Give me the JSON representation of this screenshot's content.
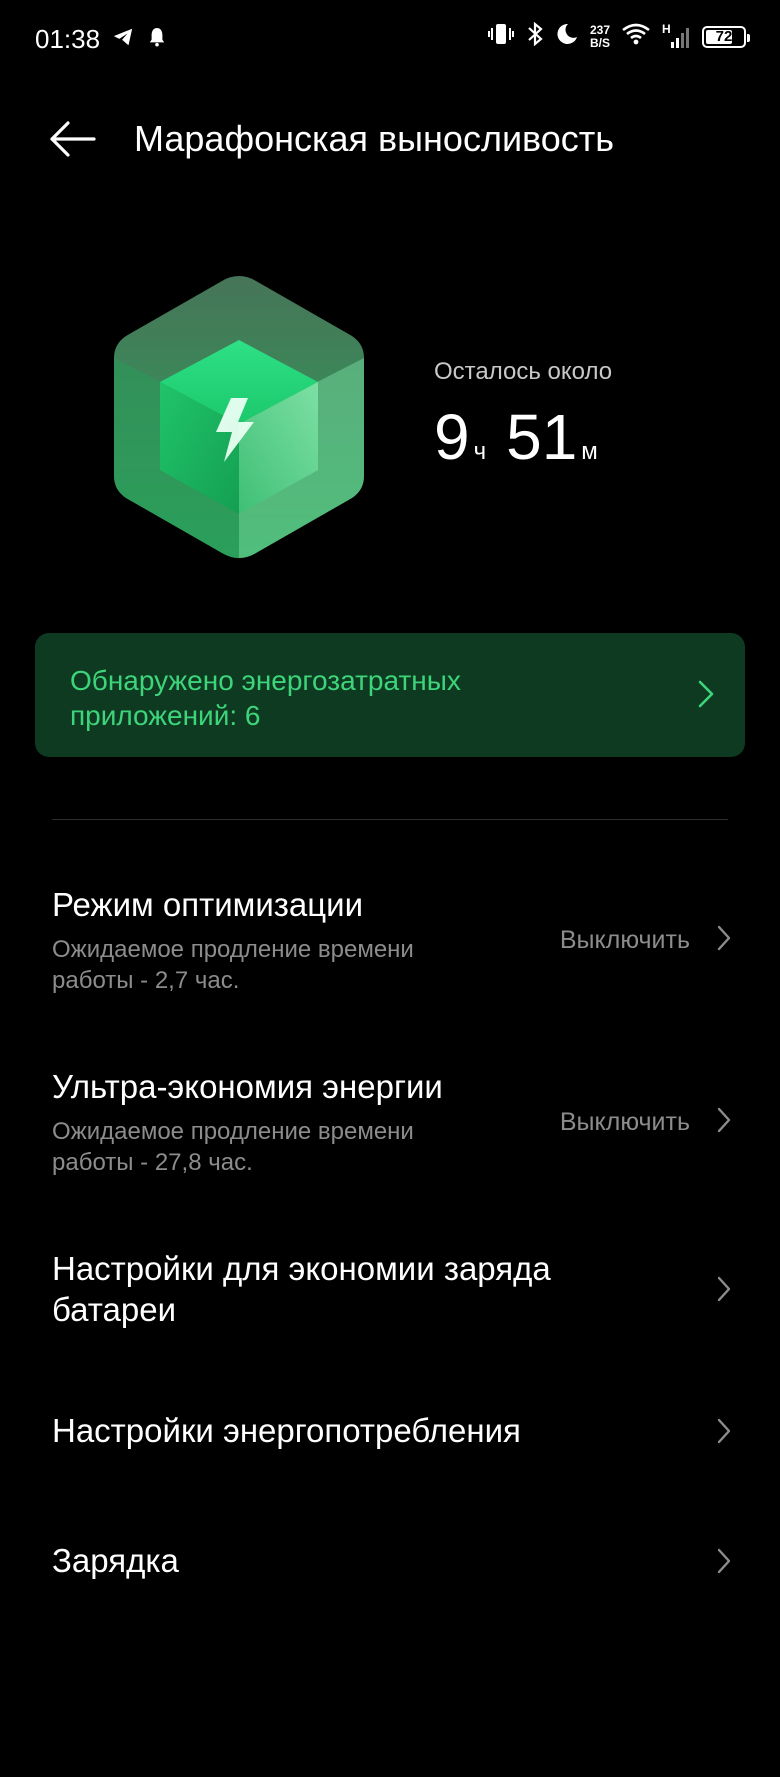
{
  "status_bar": {
    "time": "01:38",
    "net_speed_value": "237",
    "net_speed_unit": "B/S",
    "network_type": "H",
    "battery_level": "72",
    "battery_fraction": 0.72,
    "icons": [
      "telegram-icon",
      "notification-bell-icon",
      "vibrate-icon",
      "bluetooth-icon",
      "do-not-disturb-moon-icon",
      "wifi-icon",
      "signal-icon",
      "battery-icon"
    ]
  },
  "header": {
    "title": "Марафонская выносливость",
    "back_icon": "arrow-left-icon"
  },
  "hero": {
    "label": "Осталось около",
    "hours": "9",
    "hours_unit": "ч",
    "minutes": "51",
    "minutes_unit": "м",
    "graphic_icon": "battery-cube-lightning-icon"
  },
  "alert": {
    "text": "Обнаружено энергозатратных приложений: 6"
  },
  "settings": {
    "optimization": {
      "title": "Режим оптимизации",
      "subtitle": "Ожидаемое продление времени работы - 2,7 час.",
      "action": "Выключить"
    },
    "ultra": {
      "title": "Ультра-экономия энергии",
      "subtitle": "Ожидаемое продление времени работы - 27,8 час.",
      "action": "Выключить"
    },
    "battery_saving": {
      "title": "Настройки для экономии заряда батареи"
    },
    "power_consumption": {
      "title": "Настройки энергопотребления"
    },
    "charging": {
      "title": "Зарядка"
    }
  },
  "colors": {
    "background": "#000000",
    "accent_green": "#3dd47a",
    "alert_bg": "#0e3a22",
    "secondary_text": "#8c8c8c"
  }
}
